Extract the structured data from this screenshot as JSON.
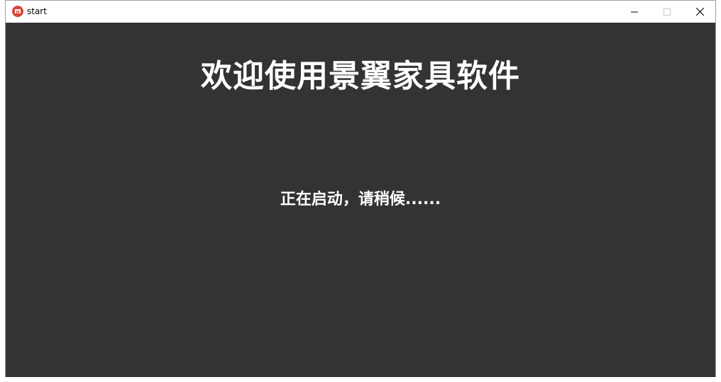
{
  "window": {
    "title": "start",
    "icon": "app-logo-icon",
    "controls": {
      "minimize": "minimize-icon",
      "maximize": "maximize-icon",
      "close": "close-icon"
    }
  },
  "splash": {
    "welcome_text": "欢迎使用景翼家具软件",
    "loading_text": "正在启动，请稍候......"
  },
  "colors": {
    "background": "#333333",
    "text": "#ffffff",
    "icon_accent": "#d9453b"
  }
}
